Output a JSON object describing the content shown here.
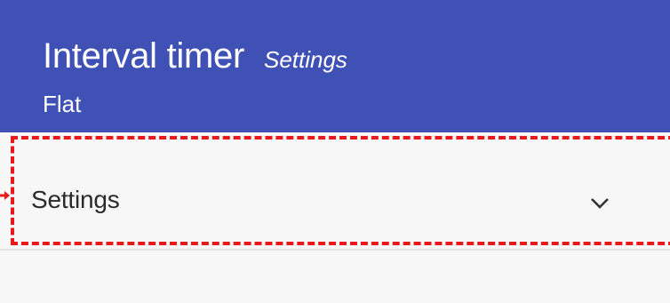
{
  "app_bar": {
    "title": "Interval timer",
    "subtitle": "Settings",
    "variant": "Flat",
    "background_color": "#3f51b5"
  },
  "settings_row": {
    "label": "Settings",
    "expand_icon": "chevron-down-icon",
    "expanded": false
  },
  "annotation": {
    "type": "highlight-box",
    "color": "#e8191a",
    "style": "dashed"
  }
}
